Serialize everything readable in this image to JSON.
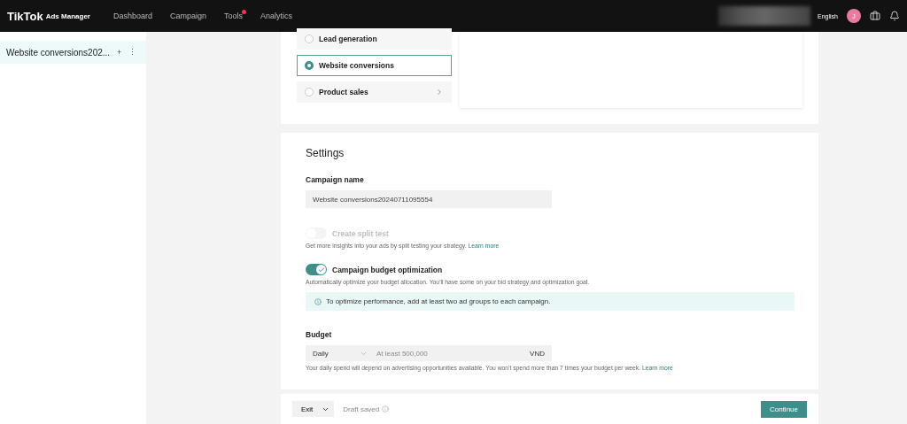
{
  "header": {
    "logo": "TikTok",
    "logo_sub": "Ads Manager",
    "nav": [
      {
        "label": "Dashboard",
        "dot": false
      },
      {
        "label": "Campaign",
        "dot": false
      },
      {
        "label": "Tools",
        "dot": true
      },
      {
        "label": "Analytics",
        "dot": false
      }
    ],
    "language": "English",
    "avatar": "J"
  },
  "sidebar": {
    "items": [
      {
        "label": "Website conversions202...",
        "selected": true
      }
    ],
    "add": "+",
    "more": "⋮"
  },
  "objectives": [
    {
      "label": "Lead generation",
      "selected": false,
      "arrow": false
    },
    {
      "label": "Website conversions",
      "selected": true,
      "arrow": false
    },
    {
      "label": "Product sales",
      "selected": false,
      "arrow": true
    }
  ],
  "settings": {
    "title": "Settings",
    "name_label": "Campaign name",
    "name_value": "Website conversions20240711095554",
    "split": {
      "label": "Create split test",
      "on": false,
      "disabled": true,
      "help": "Get more insights into your ads by split testing your strategy.",
      "link": "Learn more"
    },
    "cbo": {
      "label": "Campaign budget optimization",
      "on": true,
      "disabled": false,
      "help": "Automatically optimize your budget allocation. You'll have some on your bid strategy and optimization goal."
    },
    "notice": "To optimize performance, add at least two ad groups to each campaign.",
    "budget_label": "Budget",
    "budget_mode": "Daily",
    "budget_placeholder": "At least 500,000",
    "currency": "VND",
    "budget_help": "Your daily spend will depend on advertising opportunities available. You won't spend more than 7 times your budget per week.",
    "budget_link": "Learn more"
  },
  "footer": {
    "exit": "Exit",
    "status": "Draft saved",
    "continue": "Continue"
  }
}
